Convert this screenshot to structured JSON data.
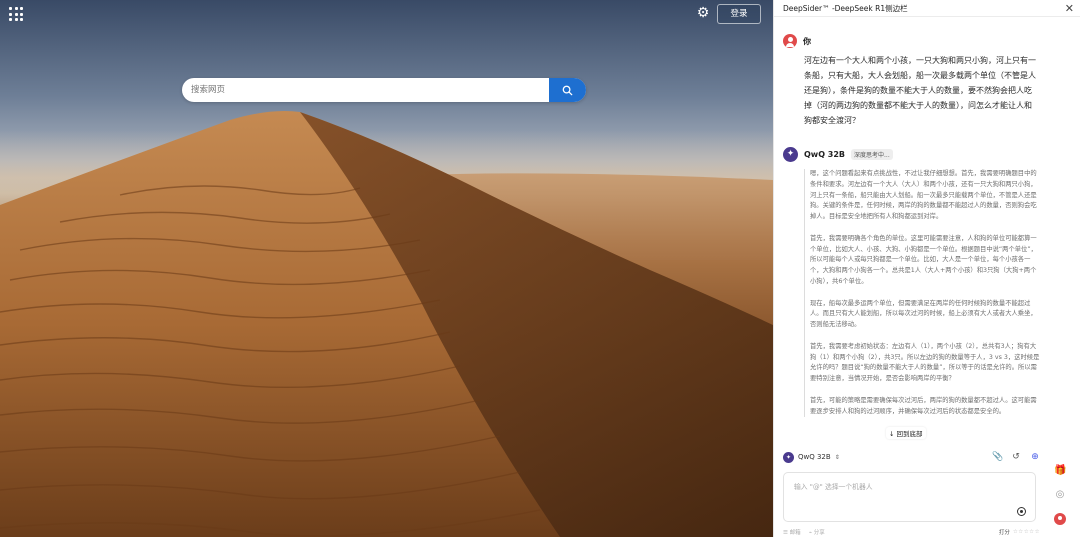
{
  "browser": {
    "login_label": "登录",
    "search_placeholder": "搜索网页",
    "icons": {
      "apps": "apps-grid-icon",
      "settings": "gear-icon",
      "search": "search-icon"
    }
  },
  "sidebar": {
    "title": "DeepSider™ -DeepSeek R1侧边栏",
    "close": "✕",
    "user": {
      "name": "你",
      "message": "河左边有一个大人和两个小孩，一只大狗和两只小狗，河上只有一条船，只有大船，大人会划船，船一次最多载两个单位（不管是人还是狗），条件是狗的数量不能大于人的数量，要不然狗会把人吃掉（河的两边狗的数量都不能大于人的数量），问怎么才能让人和狗都安全渡河？"
    },
    "bot": {
      "name": "QwQ 32B",
      "status": "深度思考中...",
      "thinking": [
        "嗯，这个问题看起来有点挑战性，不过让我仔细想想。首先，我需要明确题目中的条件和要求。河左边有一个大人（大人）和两个小孩，还有一只大狗和两只小狗，河上只有一条船，船只能由大人划船。船一次最多只能载两个单位，不管是人还是狗。关键的条件是，任何时候，两岸的狗的数量都不能超过人的数量，否则狗会吃掉人。目标是安全地把所有人和狗都运到对岸。",
        "首先，我需要明确各个角色的单位。这里可能需要注意，人和狗的单位可能都算一个单位，比如大人、小孩、大狗、小狗都是一个单位。根据题目中说“两个单位”，所以可能每个人或每只狗都是一个单位。比如，大人是一个单位，每个小孩各一个，大狗和两个小狗各一个。总共是1人（大人+两个小孩）和3只狗（大狗+两个小狗），共6个单位。",
        "现在，船每次最多运两个单位，但需要满足在两岸的任何时候狗的数量不能超过人。而且只有大人能划船，所以每次过河的时候，船上必须有大人或者大人乘坐，否则船无法移动。",
        "首先，我需要考虑初始状态：左边有人（1），两个小孩（2），总共有3人；狗有大狗（1）和两个小狗（2），共3只。所以左边的狗的数量等于人，3 vs 3，这时候是允许的吗？题目说“狗的数量不能大于人的数量”，所以等于的话是允许的。所以需要特别注意，当情况开始，是否会影响两岸的平衡？",
        "首先，可能的策略是需要确保每次过河后，两岸的狗的数量都不超过人。这可能需要逐步安排人和狗的过河顺序，并确保每次过河后的状态都是安全的。"
      ],
      "back_to_bottom": "↓ 回到底部"
    },
    "composer": {
      "model": "QwQ 32B",
      "placeholder": "输入 \"@\" 选择一个机器人",
      "icons": [
        "paperclip-icon",
        "history-icon",
        "new-chat-icon"
      ]
    },
    "footer": {
      "left": [
        "☰ 邮箱",
        "⌁ 分享"
      ],
      "rating_label": "打分",
      "stars": "☆☆☆☆☆"
    },
    "rail_icons": [
      "gift-icon",
      "target-icon",
      "user-avatar-icon"
    ]
  }
}
